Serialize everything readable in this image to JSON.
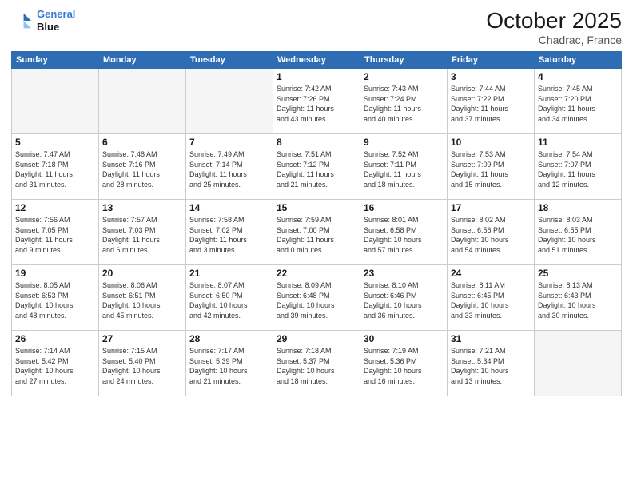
{
  "header": {
    "logo_line1": "General",
    "logo_line2": "Blue",
    "month": "October 2025",
    "location": "Chadrac, France"
  },
  "weekdays": [
    "Sunday",
    "Monday",
    "Tuesday",
    "Wednesday",
    "Thursday",
    "Friday",
    "Saturday"
  ],
  "weeks": [
    [
      {
        "day": "",
        "info": ""
      },
      {
        "day": "",
        "info": ""
      },
      {
        "day": "",
        "info": ""
      },
      {
        "day": "1",
        "info": "Sunrise: 7:42 AM\nSunset: 7:26 PM\nDaylight: 11 hours\nand 43 minutes."
      },
      {
        "day": "2",
        "info": "Sunrise: 7:43 AM\nSunset: 7:24 PM\nDaylight: 11 hours\nand 40 minutes."
      },
      {
        "day": "3",
        "info": "Sunrise: 7:44 AM\nSunset: 7:22 PM\nDaylight: 11 hours\nand 37 minutes."
      },
      {
        "day": "4",
        "info": "Sunrise: 7:45 AM\nSunset: 7:20 PM\nDaylight: 11 hours\nand 34 minutes."
      }
    ],
    [
      {
        "day": "5",
        "info": "Sunrise: 7:47 AM\nSunset: 7:18 PM\nDaylight: 11 hours\nand 31 minutes."
      },
      {
        "day": "6",
        "info": "Sunrise: 7:48 AM\nSunset: 7:16 PM\nDaylight: 11 hours\nand 28 minutes."
      },
      {
        "day": "7",
        "info": "Sunrise: 7:49 AM\nSunset: 7:14 PM\nDaylight: 11 hours\nand 25 minutes."
      },
      {
        "day": "8",
        "info": "Sunrise: 7:51 AM\nSunset: 7:12 PM\nDaylight: 11 hours\nand 21 minutes."
      },
      {
        "day": "9",
        "info": "Sunrise: 7:52 AM\nSunset: 7:11 PM\nDaylight: 11 hours\nand 18 minutes."
      },
      {
        "day": "10",
        "info": "Sunrise: 7:53 AM\nSunset: 7:09 PM\nDaylight: 11 hours\nand 15 minutes."
      },
      {
        "day": "11",
        "info": "Sunrise: 7:54 AM\nSunset: 7:07 PM\nDaylight: 11 hours\nand 12 minutes."
      }
    ],
    [
      {
        "day": "12",
        "info": "Sunrise: 7:56 AM\nSunset: 7:05 PM\nDaylight: 11 hours\nand 9 minutes."
      },
      {
        "day": "13",
        "info": "Sunrise: 7:57 AM\nSunset: 7:03 PM\nDaylight: 11 hours\nand 6 minutes."
      },
      {
        "day": "14",
        "info": "Sunrise: 7:58 AM\nSunset: 7:02 PM\nDaylight: 11 hours\nand 3 minutes."
      },
      {
        "day": "15",
        "info": "Sunrise: 7:59 AM\nSunset: 7:00 PM\nDaylight: 11 hours\nand 0 minutes."
      },
      {
        "day": "16",
        "info": "Sunrise: 8:01 AM\nSunset: 6:58 PM\nDaylight: 10 hours\nand 57 minutes."
      },
      {
        "day": "17",
        "info": "Sunrise: 8:02 AM\nSunset: 6:56 PM\nDaylight: 10 hours\nand 54 minutes."
      },
      {
        "day": "18",
        "info": "Sunrise: 8:03 AM\nSunset: 6:55 PM\nDaylight: 10 hours\nand 51 minutes."
      }
    ],
    [
      {
        "day": "19",
        "info": "Sunrise: 8:05 AM\nSunset: 6:53 PM\nDaylight: 10 hours\nand 48 minutes."
      },
      {
        "day": "20",
        "info": "Sunrise: 8:06 AM\nSunset: 6:51 PM\nDaylight: 10 hours\nand 45 minutes."
      },
      {
        "day": "21",
        "info": "Sunrise: 8:07 AM\nSunset: 6:50 PM\nDaylight: 10 hours\nand 42 minutes."
      },
      {
        "day": "22",
        "info": "Sunrise: 8:09 AM\nSunset: 6:48 PM\nDaylight: 10 hours\nand 39 minutes."
      },
      {
        "day": "23",
        "info": "Sunrise: 8:10 AM\nSunset: 6:46 PM\nDaylight: 10 hours\nand 36 minutes."
      },
      {
        "day": "24",
        "info": "Sunrise: 8:11 AM\nSunset: 6:45 PM\nDaylight: 10 hours\nand 33 minutes."
      },
      {
        "day": "25",
        "info": "Sunrise: 8:13 AM\nSunset: 6:43 PM\nDaylight: 10 hours\nand 30 minutes."
      }
    ],
    [
      {
        "day": "26",
        "info": "Sunrise: 7:14 AM\nSunset: 5:42 PM\nDaylight: 10 hours\nand 27 minutes."
      },
      {
        "day": "27",
        "info": "Sunrise: 7:15 AM\nSunset: 5:40 PM\nDaylight: 10 hours\nand 24 minutes."
      },
      {
        "day": "28",
        "info": "Sunrise: 7:17 AM\nSunset: 5:39 PM\nDaylight: 10 hours\nand 21 minutes."
      },
      {
        "day": "29",
        "info": "Sunrise: 7:18 AM\nSunset: 5:37 PM\nDaylight: 10 hours\nand 18 minutes."
      },
      {
        "day": "30",
        "info": "Sunrise: 7:19 AM\nSunset: 5:36 PM\nDaylight: 10 hours\nand 16 minutes."
      },
      {
        "day": "31",
        "info": "Sunrise: 7:21 AM\nSunset: 5:34 PM\nDaylight: 10 hours\nand 13 minutes."
      },
      {
        "day": "",
        "info": ""
      }
    ]
  ]
}
